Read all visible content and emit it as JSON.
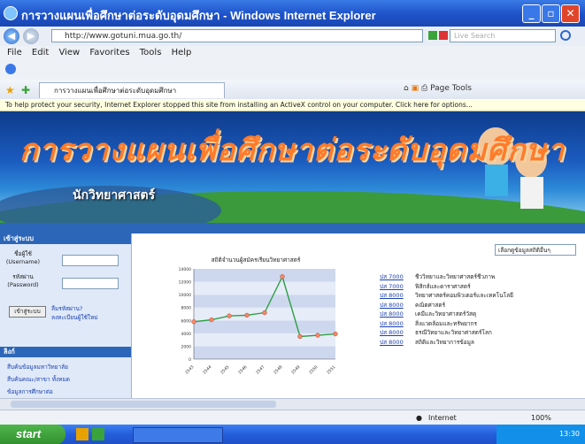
{
  "window": {
    "title": "การวางแผนเพื่อศึกษาต่อระดับอุดมศึกษา - Windows Internet Explorer",
    "min_label": "_",
    "max_label": "▫",
    "close_label": "✕"
  },
  "address": {
    "url": "http://www.gotuni.mua.go.th/",
    "back": "◀",
    "forward": "▶",
    "search_placeholder": "Live Search"
  },
  "menu": [
    "File",
    "Edit",
    "View",
    "Favorites",
    "Tools",
    "Help"
  ],
  "tab": {
    "label": "การวางแผนเพื่อศึกษาต่อระดับอุดมศึกษา"
  },
  "commandbar": {
    "page": "Page",
    "tools": "Tools"
  },
  "infobar": {
    "text": "To help protect your security, Internet Explorer stopped this site from installing an ActiveX control on your computer. Click here for options..."
  },
  "banner": {
    "title": "การวางแผนเพื่อศึกษาต่อระดับอุดมศึกษา",
    "subtitle": "นักวิทยาศาสตร์"
  },
  "sidebar": {
    "login_title": "เข้าสู่ระบบ",
    "username_label": "ชื่อผู้ใช้ (Username)",
    "password_label": "รหัสผ่าน (Password)",
    "login_button": "เข้าสู่ระบบ",
    "forgot_link": "ลืมรหัสผ่าน?",
    "register_link": "ลงทะเบียนผู้ใช้ใหม่",
    "links_title": "ลิงก์",
    "links": [
      "สืบค้นข้อมูลมหาวิทยาลัย",
      "สืบค้นคณะ/สาขา ทั้งหมด",
      "ข้อมูลการศึกษาต่อ"
    ]
  },
  "main": {
    "dropdown": "เลือกดูข้อมูลสถิติอื่นๆ",
    "legend": [
      {
        "code": "ปส 7000",
        "text": "ชีววิทยาและวิทยาศาสตร์ชีวภาพ"
      },
      {
        "code": "ปส 7000",
        "text": "ฟิสิกส์และดาราศาสตร์"
      },
      {
        "code": "ปส 8000",
        "text": "วิทยาศาสตร์คอมพิวเตอร์และเทคโนโลยี"
      },
      {
        "code": "ปส 8000",
        "text": "คณิตศาสตร์"
      },
      {
        "code": "ปส 8000",
        "text": "เคมีและวิทยาศาสตร์วัสดุ"
      },
      {
        "code": "ปส 8000",
        "text": "สิ่งแวดล้อมและทรัพยากร"
      },
      {
        "code": "ปส 8000",
        "text": "ธรณีวิทยาและวิทยาศาสตร์โลก"
      },
      {
        "code": "ปส 8000",
        "text": "สถิติและวิทยาการข้อมูล"
      }
    ]
  },
  "chart_data": {
    "type": "line",
    "title": "สถิติจำนวนผู้สมัครเรียนวิทยาศาสตร์",
    "x": [
      "2543",
      "2544",
      "2545",
      "2546",
      "2547",
      "2548",
      "2549",
      "2550",
      "2551"
    ],
    "series": [
      {
        "values": [
          5800,
          6100,
          6700,
          6800,
          7200,
          12800,
          3500,
          3700,
          3900
        ]
      }
    ],
    "ylim": [
      0,
      14000
    ]
  },
  "status": {
    "zone": "Internet",
    "zoom": "100%"
  },
  "taskbar": {
    "start": "start",
    "time": "13:30"
  },
  "colors": {
    "title_blue": "#1d52c9",
    "banner_orange": "#ff7b2a",
    "chart_line": "#2f9e44"
  }
}
